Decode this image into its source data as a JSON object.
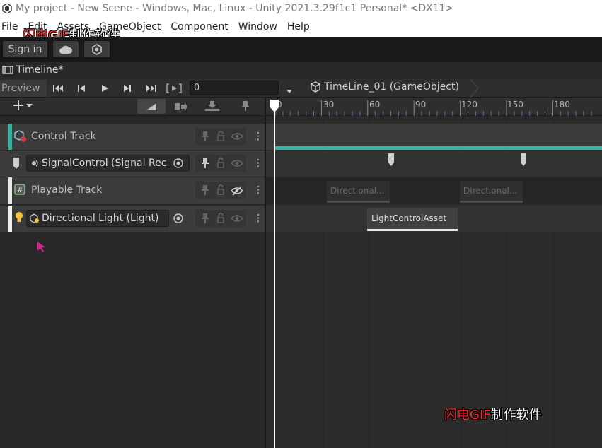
{
  "window": {
    "title": "My project - New Scene - Windows, Mac, Linux - Unity 2021.3.29f1c1 Personal* <DX11>"
  },
  "menu": {
    "items": [
      "File",
      "Edit",
      "Assets",
      "GameObject",
      "Component",
      "Window",
      "Help"
    ]
  },
  "watermark": {
    "red": "闪电GIF",
    "white": "制作软件"
  },
  "toolbar": {
    "sign_in_label": "Sign in"
  },
  "tab": {
    "label": "Timeline*"
  },
  "controls": {
    "preview_label": "Preview",
    "frame_value": "0",
    "gameobject_label": "TimeLine_01 (GameObject)"
  },
  "ruler": {
    "labels": [
      "0",
      "30",
      "60",
      "90",
      "120",
      "150",
      "180"
    ]
  },
  "tracks": [
    {
      "name": "Control Track",
      "accent": "#29b9a6"
    },
    {
      "binding": "SignalControl (Signal Rec",
      "accent": "#c8c8c8"
    },
    {
      "name": "Playable Track",
      "accent": "#e6e6e6"
    },
    {
      "binding": "Directional Light (Light)",
      "accent": "#f0f0f0"
    }
  ],
  "clips": {
    "playable_1": "Directional...",
    "playable_2": "Directional...",
    "light": "LightControlAsset"
  },
  "colors": {
    "control_accent": "#29b9a6",
    "playhead": "#ffffff",
    "watermark_red": "#ff2a2a"
  }
}
